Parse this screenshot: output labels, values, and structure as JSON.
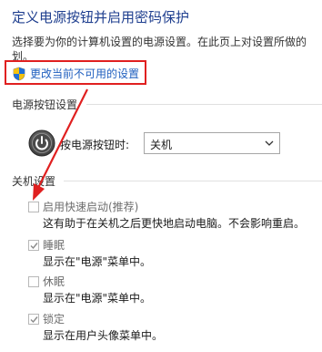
{
  "page": {
    "title": "定义电源按钮并启用密码保护",
    "description_line1": "选择要为你的计算机设置的电源设置。在此页上对设置所做的",
    "description_line2": "划。"
  },
  "change_settings_link": {
    "label": "更改当前不可用的设置",
    "icon": "uac-shield-icon"
  },
  "power_button_section": {
    "heading": "电源按钮设置",
    "icon": "power-icon",
    "label": "按电源按钮时:",
    "selected_option": "关机"
  },
  "shutdown_section": {
    "heading": "关机设置",
    "options": [
      {
        "label": "启用快速启动(推荐)",
        "description": "这有助于在关机之后更快地启动电脑。不会影响重启。",
        "checked": false,
        "disabled": true
      },
      {
        "label": "睡眠",
        "description": "显示在\"电源\"菜单中。",
        "checked": true,
        "disabled": true
      },
      {
        "label": "休眠",
        "description": "显示在\"电源\"菜单中。",
        "checked": false,
        "disabled": true
      },
      {
        "label": "锁定",
        "description": "显示在用户头像菜单中。",
        "checked": true,
        "disabled": true
      }
    ]
  },
  "colors": {
    "title": "#1f3f8f",
    "link": "#1f5fbf",
    "highlight": "#e02020"
  }
}
